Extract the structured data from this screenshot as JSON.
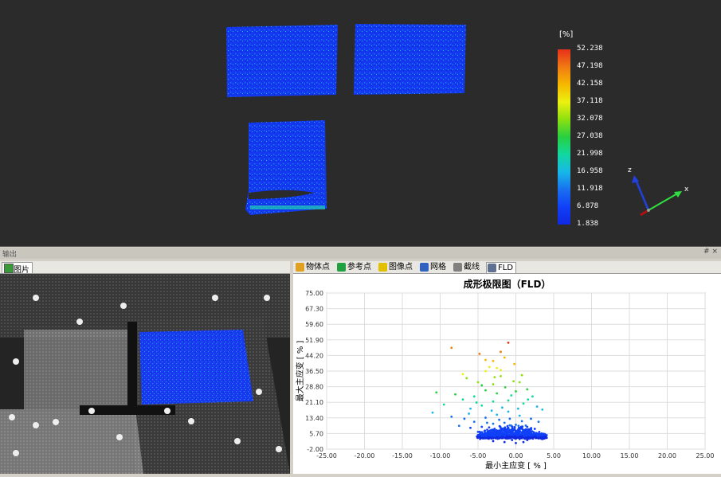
{
  "viewport": {
    "scale_unit": "[%]",
    "scale_ticks": [
      "52.238",
      "47.198",
      "42.158",
      "37.118",
      "32.078",
      "27.038",
      "21.998",
      "16.958",
      "11.918",
      "6.878",
      "1.838"
    ],
    "scale_colors": [
      "#e8301a",
      "#f07a12",
      "#f5b800",
      "#ecf010",
      "#8de010",
      "#28d040",
      "#10d8a0",
      "#18b8e8",
      "#1870f0",
      "#1040f8",
      "#1028e0"
    ],
    "axis_labels": {
      "x": "x",
      "z": "z"
    }
  },
  "output_panel": {
    "title": "输出",
    "pin": "# ×"
  },
  "left_panel": {
    "tab_label": "图片"
  },
  "right_panel": {
    "tabs": [
      {
        "label": "物体点",
        "icon": "object-points-icon",
        "color": "#e0a020"
      },
      {
        "label": "参考点",
        "icon": "reference-points-icon",
        "color": "#20a040"
      },
      {
        "label": "图像点",
        "icon": "image-points-icon",
        "color": "#e0c000"
      },
      {
        "label": "网格",
        "icon": "mesh-icon",
        "color": "#3060c0"
      },
      {
        "label": "截线",
        "icon": "section-line-icon",
        "color": "#808080"
      },
      {
        "label": "FLD",
        "icon": "fld-chart-icon",
        "color": "#607090"
      }
    ],
    "active_tab": "FLD"
  },
  "chart_data": {
    "type": "scatter",
    "title": "成形极限图（FLD）",
    "xlabel": "最小主应变 [ % ]",
    "ylabel": "最大主应变 [ % ]",
    "xlim": [
      -25,
      25
    ],
    "ylim": [
      -2,
      75
    ],
    "x_ticks": [
      "-25.00",
      "-20.00",
      "-15.00",
      "-10.00",
      "-5.00",
      "0.00",
      "5.00",
      "10.00",
      "15.00",
      "20.00",
      "25.00"
    ],
    "y_ticks": [
      "75.00",
      "67.30",
      "59.60",
      "51.90",
      "44.20",
      "36.50",
      "28.80",
      "21.10",
      "13.40",
      "5.70",
      "-2.00"
    ],
    "grid": true,
    "color_scale": "strain magnitude 1.838 (blue) to 52.238 (red)",
    "points": [
      [
        -8.5,
        48.0
      ],
      [
        -1.0,
        50.5
      ],
      [
        -2.0,
        46.0
      ],
      [
        -4.8,
        45.0
      ],
      [
        -1.5,
        43.2
      ],
      [
        -4.0,
        42.0
      ],
      [
        -3.0,
        41.5
      ],
      [
        -0.2,
        40.0
      ],
      [
        -3.5,
        38.5
      ],
      [
        -2.5,
        38.0
      ],
      [
        -2.0,
        37.0
      ],
      [
        -4.0,
        36.5
      ],
      [
        -7.0,
        35.0
      ],
      [
        -6.5,
        33.0
      ],
      [
        -5.0,
        31.0
      ],
      [
        -2.0,
        34.0
      ],
      [
        0.8,
        34.5
      ],
      [
        -4.5,
        29.5
      ],
      [
        -3.0,
        30.0
      ],
      [
        0.5,
        31.0
      ],
      [
        -10.5,
        26.0
      ],
      [
        -8.0,
        25.0
      ],
      [
        -9.5,
        20.0
      ],
      [
        -7.0,
        22.5
      ],
      [
        -5.5,
        24.0
      ],
      [
        -4.0,
        27.0
      ],
      [
        -2.5,
        25.5
      ],
      [
        0.0,
        26.5
      ],
      [
        1.5,
        27.5
      ],
      [
        2.2,
        24.0
      ],
      [
        -6.0,
        18.0
      ],
      [
        -4.5,
        19.5
      ],
      [
        -3.0,
        21.5
      ],
      [
        -1.0,
        22.0
      ],
      [
        1.0,
        20.5
      ],
      [
        2.8,
        19.0
      ],
      [
        3.5,
        17.5
      ],
      [
        -11.0,
        16.0
      ],
      [
        -8.5,
        14.0
      ],
      [
        -6.8,
        13.0
      ],
      [
        -5.5,
        11.5
      ],
      [
        -4.0,
        13.5
      ],
      [
        -2.5,
        15.0
      ],
      [
        -1.0,
        16.5
      ],
      [
        0.5,
        14.5
      ],
      [
        2.0,
        13.0
      ],
      [
        3.0,
        11.5
      ],
      [
        -7.5,
        9.5
      ],
      [
        -6.0,
        8.5
      ],
      [
        -4.5,
        9.0
      ],
      [
        -3.0,
        10.5
      ],
      [
        -1.5,
        11.0
      ],
      [
        0.0,
        10.0
      ],
      [
        1.5,
        9.0
      ],
      [
        2.5,
        8.0
      ],
      [
        -5.0,
        6.5
      ],
      [
        -3.5,
        7.0
      ],
      [
        -2.0,
        6.0
      ],
      [
        -0.5,
        7.5
      ],
      [
        1.0,
        6.0
      ],
      [
        2.0,
        5.0
      ],
      [
        -4.0,
        4.5
      ],
      [
        -2.5,
        3.5
      ],
      [
        -1.0,
        4.0
      ],
      [
        0.5,
        3.0
      ],
      [
        1.5,
        2.5
      ],
      [
        -3.0,
        2.0
      ],
      [
        -1.5,
        1.5
      ],
      [
        0.0,
        1.0
      ],
      [
        1.0,
        1.5
      ],
      [
        -0.5,
        2.5
      ],
      [
        -2.0,
        5.0
      ],
      [
        -3.5,
        5.5
      ],
      [
        0.2,
        5.2
      ],
      [
        -1.0,
        8.5
      ],
      [
        -2.8,
        8.0
      ],
      [
        0.8,
        11.8
      ],
      [
        -0.8,
        13.0
      ],
      [
        -2.2,
        12.5
      ],
      [
        -3.8,
        11.0
      ],
      [
        -1.8,
        18.5
      ],
      [
        0.3,
        18.0
      ],
      [
        -3.2,
        17.0
      ],
      [
        -0.6,
        24.5
      ],
      [
        -1.4,
        28.5
      ],
      [
        -0.3,
        31.5
      ],
      [
        -2.8,
        33.5
      ],
      [
        1.6,
        22.5
      ],
      [
        -5.2,
        21.0
      ],
      [
        -6.2,
        15.5
      ]
    ]
  }
}
